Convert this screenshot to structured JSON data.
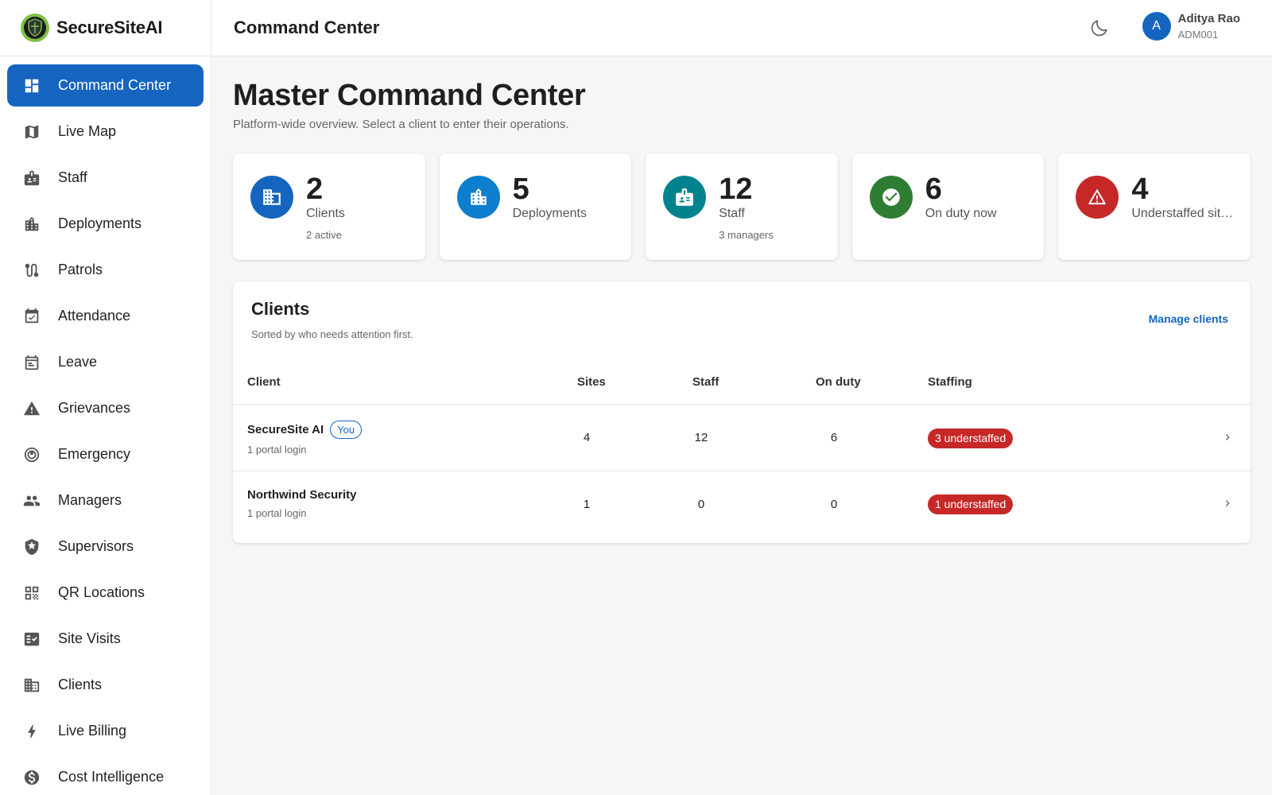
{
  "app": {
    "name": "SecureSiteAI"
  },
  "header": {
    "title": "Command Center",
    "user_name": "Aditya Rao",
    "user_id": "ADM001",
    "avatar_initial": "A"
  },
  "sidebar": {
    "items": [
      {
        "label": "Command Center",
        "icon": "dashboard-icon",
        "active": true
      },
      {
        "label": "Live Map",
        "icon": "map-icon"
      },
      {
        "label": "Staff",
        "icon": "badge-icon"
      },
      {
        "label": "Deployments",
        "icon": "building-icon"
      },
      {
        "label": "Patrols",
        "icon": "route-icon"
      },
      {
        "label": "Attendance",
        "icon": "calendar-check-icon"
      },
      {
        "label": "Leave",
        "icon": "calendar-icon"
      },
      {
        "label": "Grievances",
        "icon": "warning-icon"
      },
      {
        "label": "Emergency",
        "icon": "emergency-icon"
      },
      {
        "label": "Managers",
        "icon": "people-icon"
      },
      {
        "label": "Supervisors",
        "icon": "shield-star-icon"
      },
      {
        "label": "QR Locations",
        "icon": "qr-code-icon"
      },
      {
        "label": "Site Visits",
        "icon": "fact-check-icon"
      },
      {
        "label": "Clients",
        "icon": "domain-icon"
      },
      {
        "label": "Live Billing",
        "icon": "bolt-icon"
      },
      {
        "label": "Cost Intelligence",
        "icon": "dollar-icon"
      }
    ]
  },
  "main": {
    "title": "Master Command Center",
    "subtitle": "Platform-wide overview. Select a client to enter their operations.",
    "stats": [
      {
        "value": "2",
        "label": "Clients",
        "sub": "2 active",
        "icon": "domain-icon",
        "color": "#1565c0"
      },
      {
        "value": "5",
        "label": "Deployments",
        "sub": "",
        "icon": "building-icon",
        "color": "#0d7fce"
      },
      {
        "value": "12",
        "label": "Staff",
        "sub": "3 managers",
        "icon": "badge-icon",
        "color": "#00838f"
      },
      {
        "value": "6",
        "label": "On duty now",
        "sub": "",
        "icon": "check-circle-icon",
        "color": "#2e7d32"
      },
      {
        "value": "4",
        "label": "Understaffed sites",
        "sub": "",
        "icon": "warning-icon",
        "color": "#c62828"
      }
    ],
    "clients": {
      "title": "Clients",
      "subtitle": "Sorted by who needs attention first.",
      "manage_label": "Manage clients",
      "columns": [
        "Client",
        "Sites",
        "Staff",
        "On duty",
        "Staffing"
      ],
      "rows": [
        {
          "name": "SecureSite AI",
          "badge": "You",
          "meta": "1 portal login",
          "sites": "4",
          "staff": "12",
          "on_duty": "6",
          "staffing": "3 understaffed"
        },
        {
          "name": "Northwind Security",
          "badge": "",
          "meta": "1 portal login",
          "sites": "1",
          "staff": "0",
          "on_duty": "0",
          "staffing": "1 understaffed"
        }
      ]
    }
  },
  "colors": {
    "accent": "#1565c0",
    "danger": "#c62828",
    "success": "#2e7d32"
  }
}
